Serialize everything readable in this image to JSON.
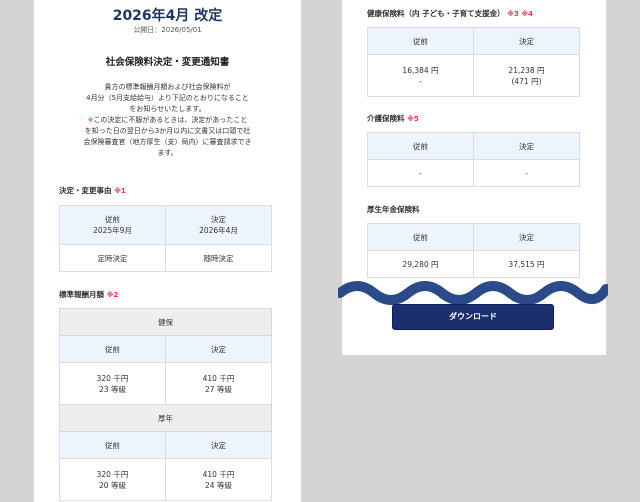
{
  "header": {
    "title": "2026年4月 改定",
    "published_date": "公開日：2026/05/01"
  },
  "notice": {
    "title": "社会保険料決定・変更通知書",
    "body_lines": [
      "貴方の標準報酬月額および社会保険料が",
      "4月分（5月支給給与）より下記のとおりになること",
      "をお知らせいたします。"
    ],
    "caution_mark": "※",
    "caution_lines": [
      "この決定に不服があるときは、決定があったこと",
      "を知った日の翌日から3か月以内に文書又は口頭で社",
      "会保険審査官（地方厚生（支）局内）に審査請求でき",
      "ます。"
    ]
  },
  "reason": {
    "label": "決定・変更事由",
    "mark": "※1",
    "headers": [
      "従前",
      "決定"
    ],
    "periods": [
      "2025年9月",
      "2026年4月"
    ],
    "values": [
      "定時決定",
      "随時決定"
    ]
  },
  "standard_monthly": {
    "label": "標準報酬月額",
    "mark": "※2",
    "groups": [
      {
        "name": "健保",
        "headers": [
          "従前",
          "決定"
        ],
        "before": [
          "320 千円",
          "23 等級"
        ],
        "after": [
          "410 千円",
          "27 等級"
        ]
      },
      {
        "name": "厚年",
        "headers": [
          "従前",
          "決定"
        ],
        "before": [
          "320 千円",
          "20 等級"
        ],
        "after": [
          "410 千円",
          "24 等級"
        ]
      }
    ]
  },
  "health_insurance": {
    "label": "健康保険料（内 子ども・子育て支援金）",
    "marks": "※3 ※4",
    "headers": [
      "従前",
      "決定"
    ],
    "before": [
      "16,384 円",
      "-"
    ],
    "after": [
      "21,238 円",
      "(471 円)"
    ]
  },
  "care_insurance": {
    "label": "介護保険料",
    "mark": "※5",
    "headers": [
      "従前",
      "決定"
    ],
    "before": "-",
    "after": "-"
  },
  "pension": {
    "label": "厚生年金保険料",
    "headers": [
      "従前",
      "決定"
    ],
    "before": "29,280 円",
    "after": "37,515 円"
  },
  "download_button": "ダウンロード",
  "colors": {
    "title": "#1f3566",
    "accent_red": "#e8334a",
    "header_cell": "#eef4fb",
    "button": "#1b2f6e",
    "wave": "#2b4a8a"
  }
}
